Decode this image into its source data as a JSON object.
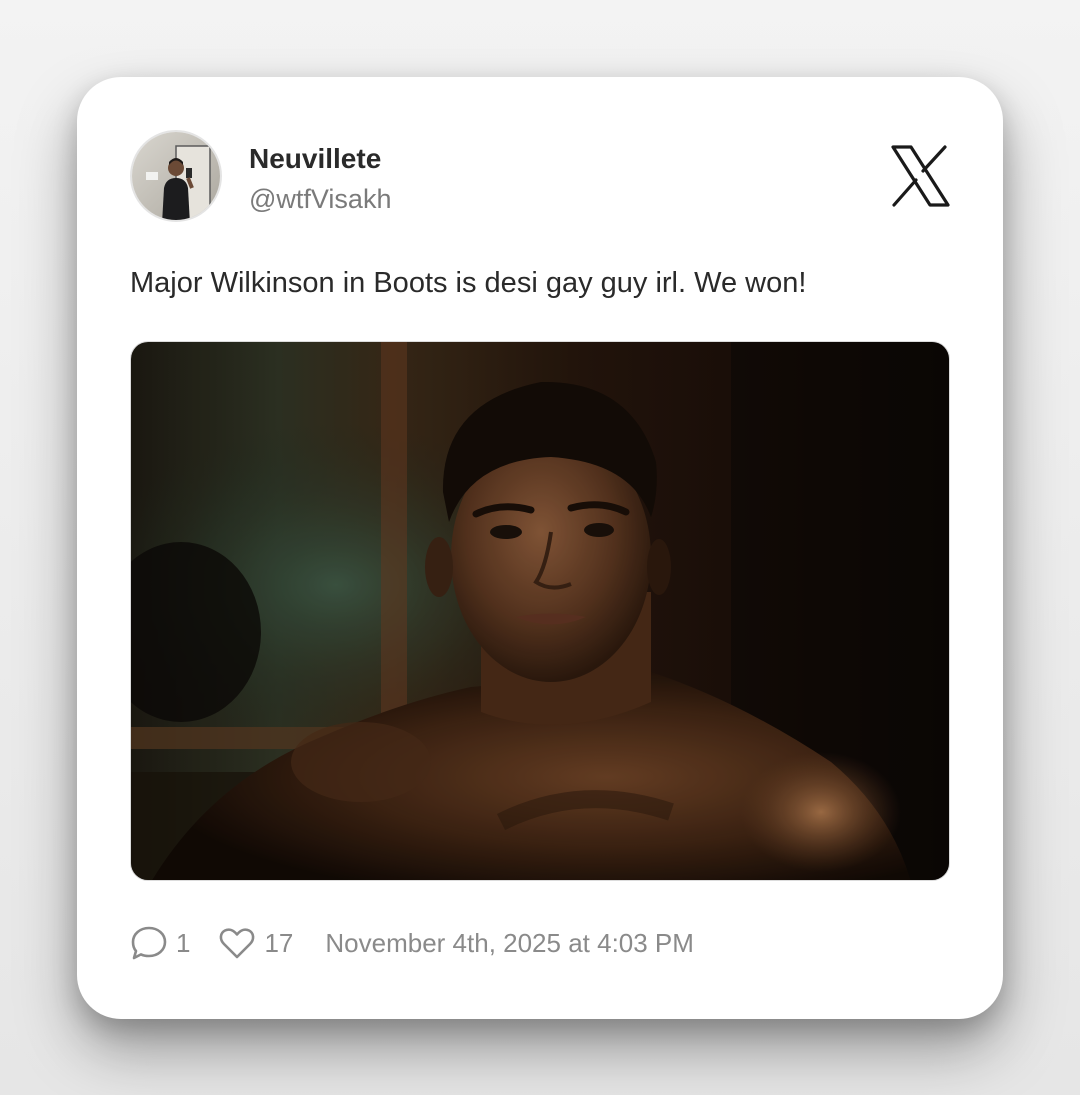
{
  "tweet": {
    "author": {
      "display_name": "Neuvillete",
      "handle": "@wtfVisakh"
    },
    "text": "Major Wilkinson in Boots is desi gay guy irl. We won!",
    "stats": {
      "replies": "1",
      "likes": "17"
    },
    "timestamp": "November 4th, 2025 at 4:03 PM"
  },
  "icons": {
    "brand": "x-logo-icon",
    "reply": "speech-bubble-icon",
    "like": "heart-icon"
  },
  "colors": {
    "background": "#eeeeee",
    "card": "#ffffff",
    "text": "#2a2a2a",
    "muted": "#7a7a7a"
  }
}
